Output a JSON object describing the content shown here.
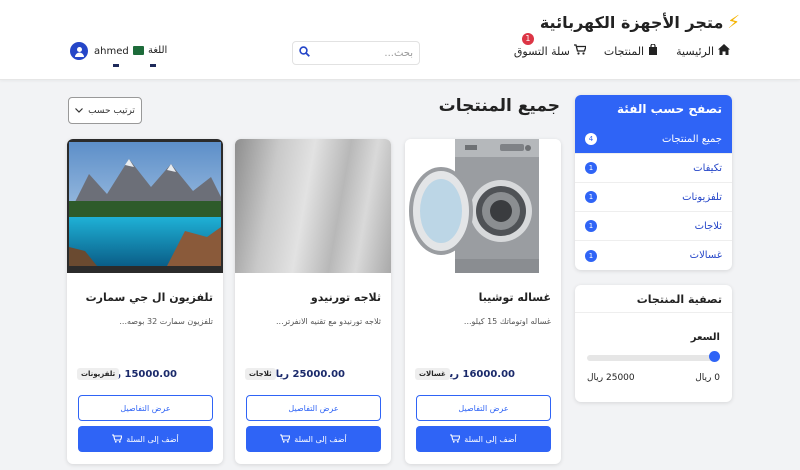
{
  "brand": {
    "bolt": "⚡",
    "name": "متجر الأجهزة الكهربائية"
  },
  "nav": {
    "home": "الرئيسية",
    "products": "المنتجات",
    "cart": "سلة التسوق",
    "cart_count": "1"
  },
  "search": {
    "placeholder": "بحث..."
  },
  "language": {
    "label": "اللغة"
  },
  "user": {
    "name": "ahmed"
  },
  "categories": {
    "title": "تصفح حسب الفئة",
    "items": [
      {
        "label": "جميع المنتجات",
        "count": "4"
      },
      {
        "label": "تكيفات",
        "count": "1"
      },
      {
        "label": "تلفزيونات",
        "count": "1"
      },
      {
        "label": "ثلاجات",
        "count": "1"
      },
      {
        "label": "غسالات",
        "count": "1"
      }
    ]
  },
  "filter": {
    "title": "تصفية المنتجات",
    "price_label": "السعر",
    "min": "0 ريال",
    "max": "25000 ريال",
    "slider_value": 0
  },
  "main": {
    "title": "جميع المنتجات",
    "sort_label": "ترتيب حسب"
  },
  "products": [
    {
      "name": "غساله توشيبا",
      "desc": "غساله اوتوماتك 15 كيلو...",
      "price": "16000.00 ريال",
      "tag": "غسالات",
      "details": "عرض التفاصيل",
      "add": "أضف إلى السلة"
    },
    {
      "name": "ثلاجه تورنيدو",
      "desc": "ثلاجه تورنيدو مع تقنيه الانفرتر...",
      "price": "25000.00 ريال",
      "tag": "ثلاجات",
      "details": "عرض التفاصيل",
      "add": "أضف إلى السلة"
    },
    {
      "name": "تلفزيون ال جي سمارت",
      "desc": "تلفزيون سمارت 32 بوصه...",
      "price": "15000.00 ريال",
      "tag": "تلفزيونات",
      "details": "عرض التفاصيل",
      "add": "أضف إلى السلة"
    }
  ],
  "colors": {
    "primary": "#2f64f6",
    "price": "#1b2a6b",
    "badge": "#dc3545",
    "bolt": "#f5b300"
  },
  "icons": [
    "home-icon",
    "bag-icon",
    "cart-icon",
    "search-icon",
    "flag-icon",
    "user-icon",
    "chevron-down-icon",
    "cart-plus-icon"
  ]
}
